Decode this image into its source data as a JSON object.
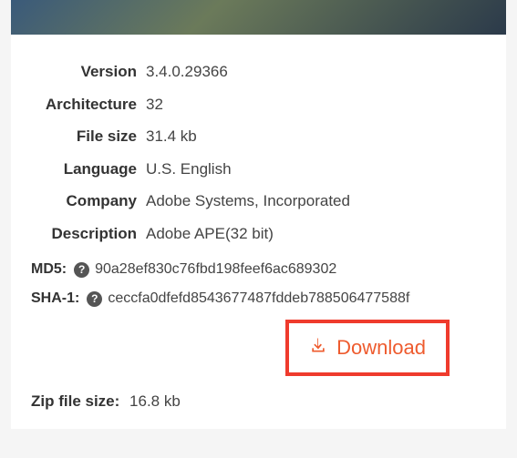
{
  "details": {
    "version_label": "Version",
    "version_value": "3.4.0.29366",
    "architecture_label": "Architecture",
    "architecture_value": "32",
    "filesize_label": "File size",
    "filesize_value": "31.4 kb",
    "language_label": "Language",
    "language_value": "U.S. English",
    "company_label": "Company",
    "company_value": "Adobe Systems, Incorporated",
    "description_label": "Description",
    "description_value": "Adobe APE(32 bit)"
  },
  "hashes": {
    "md5_label": "MD5:",
    "md5_value": "90a28ef830c76fbd198feef6ac689302",
    "sha1_label": "SHA-1:",
    "sha1_value": "ceccfa0dfefd8543677487fddeb788506477588f",
    "help_glyph": "?"
  },
  "download": {
    "label": "Download"
  },
  "zip": {
    "label": "Zip file size:",
    "value": "16.8 kb"
  }
}
